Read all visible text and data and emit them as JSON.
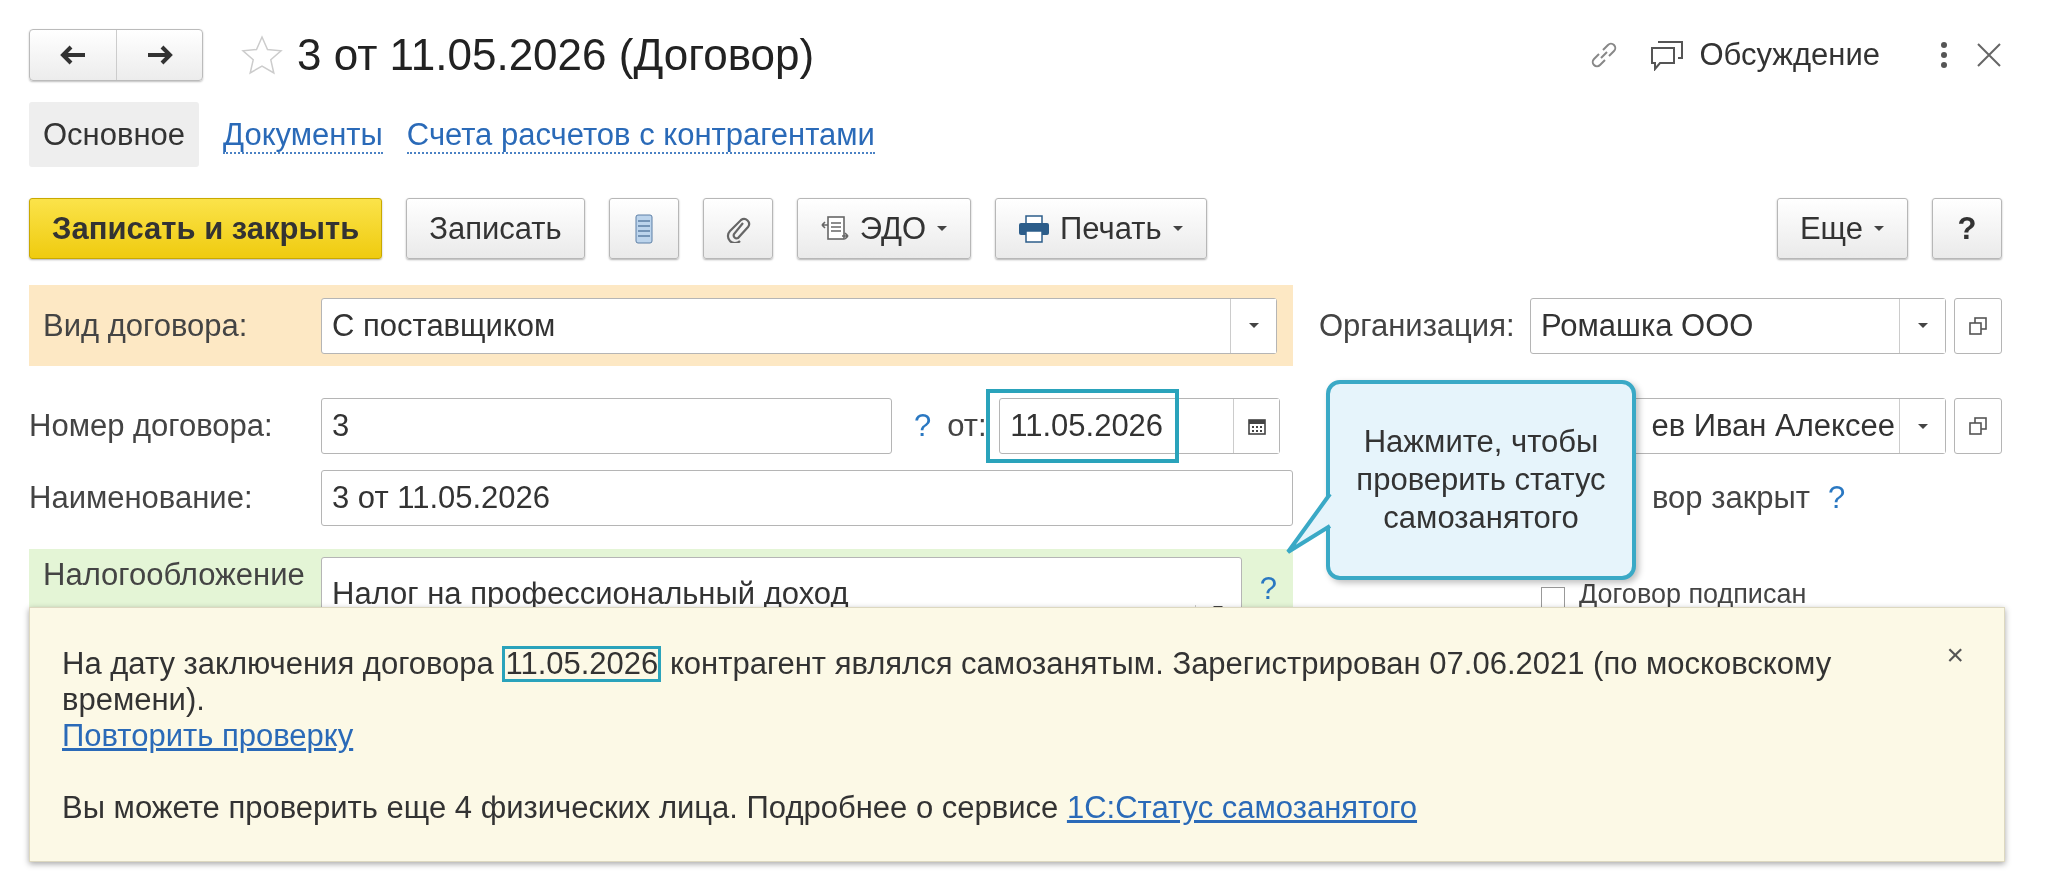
{
  "window": {
    "title": "3 от 11.05.2026 (Договор)",
    "favorite": false,
    "discussion": "Обсуждение"
  },
  "tabs": [
    {
      "label": "Основное",
      "selected": true
    },
    {
      "label": "Документы",
      "selected": false
    },
    {
      "label": "Счета расчетов с контрагентами",
      "selected": false
    }
  ],
  "toolbar": [
    {
      "kind": "primary",
      "label": "Записать и закрыть"
    },
    {
      "kind": "text",
      "label": "Записать"
    },
    {
      "kind": "icon"
    },
    {
      "kind": "icon"
    },
    {
      "kind": "menu",
      "label": "ЭДО"
    },
    {
      "kind": "menu",
      "label": "Печать"
    },
    {
      "kind": "spacer"
    },
    {
      "kind": "menu",
      "label": "Еще"
    },
    {
      "kind": "text",
      "label": "?"
    }
  ],
  "form": {
    "contract_type": {
      "label": "Вид договора:",
      "value": "С поставщиком"
    },
    "number": {
      "label": "Номер договора:",
      "value": "3",
      "help": "?",
      "date_label": "от:",
      "date": "11.05.2026",
      "date_highlighted": true
    },
    "name": {
      "label": "Наименование:",
      "value": "3 от 11.05.2026"
    },
    "taxation": {
      "label": "Налогообложение",
      "value": "Налог на профессиональный доход",
      "help": "?"
    },
    "organization": {
      "label": "Организация:",
      "value": "Ромашка ООО"
    },
    "counterparty": {
      "value": "ев Иван Алексее"
    },
    "closed": {
      "label": "вор закрыт",
      "help": "?"
    },
    "signed": {
      "label": "Договор подписан",
      "checked": false
    }
  },
  "callout": {
    "text": "Нажмите, чтобы проверить статус самозанятого"
  },
  "notice": {
    "before": "На дату заключения договора ",
    "date": "11.05.2026",
    "date_highlighted": true,
    "after": " контрагент являлся самозанятым. Зарегистрирован 07.06.2021 (по московскому времени).",
    "retry_link": "Повторить проверку",
    "info": "Вы можете проверить еще 4 физических лица. Подробнее о сервисе ",
    "service_link": "1С:Статус самозанятого",
    "close": "×"
  }
}
